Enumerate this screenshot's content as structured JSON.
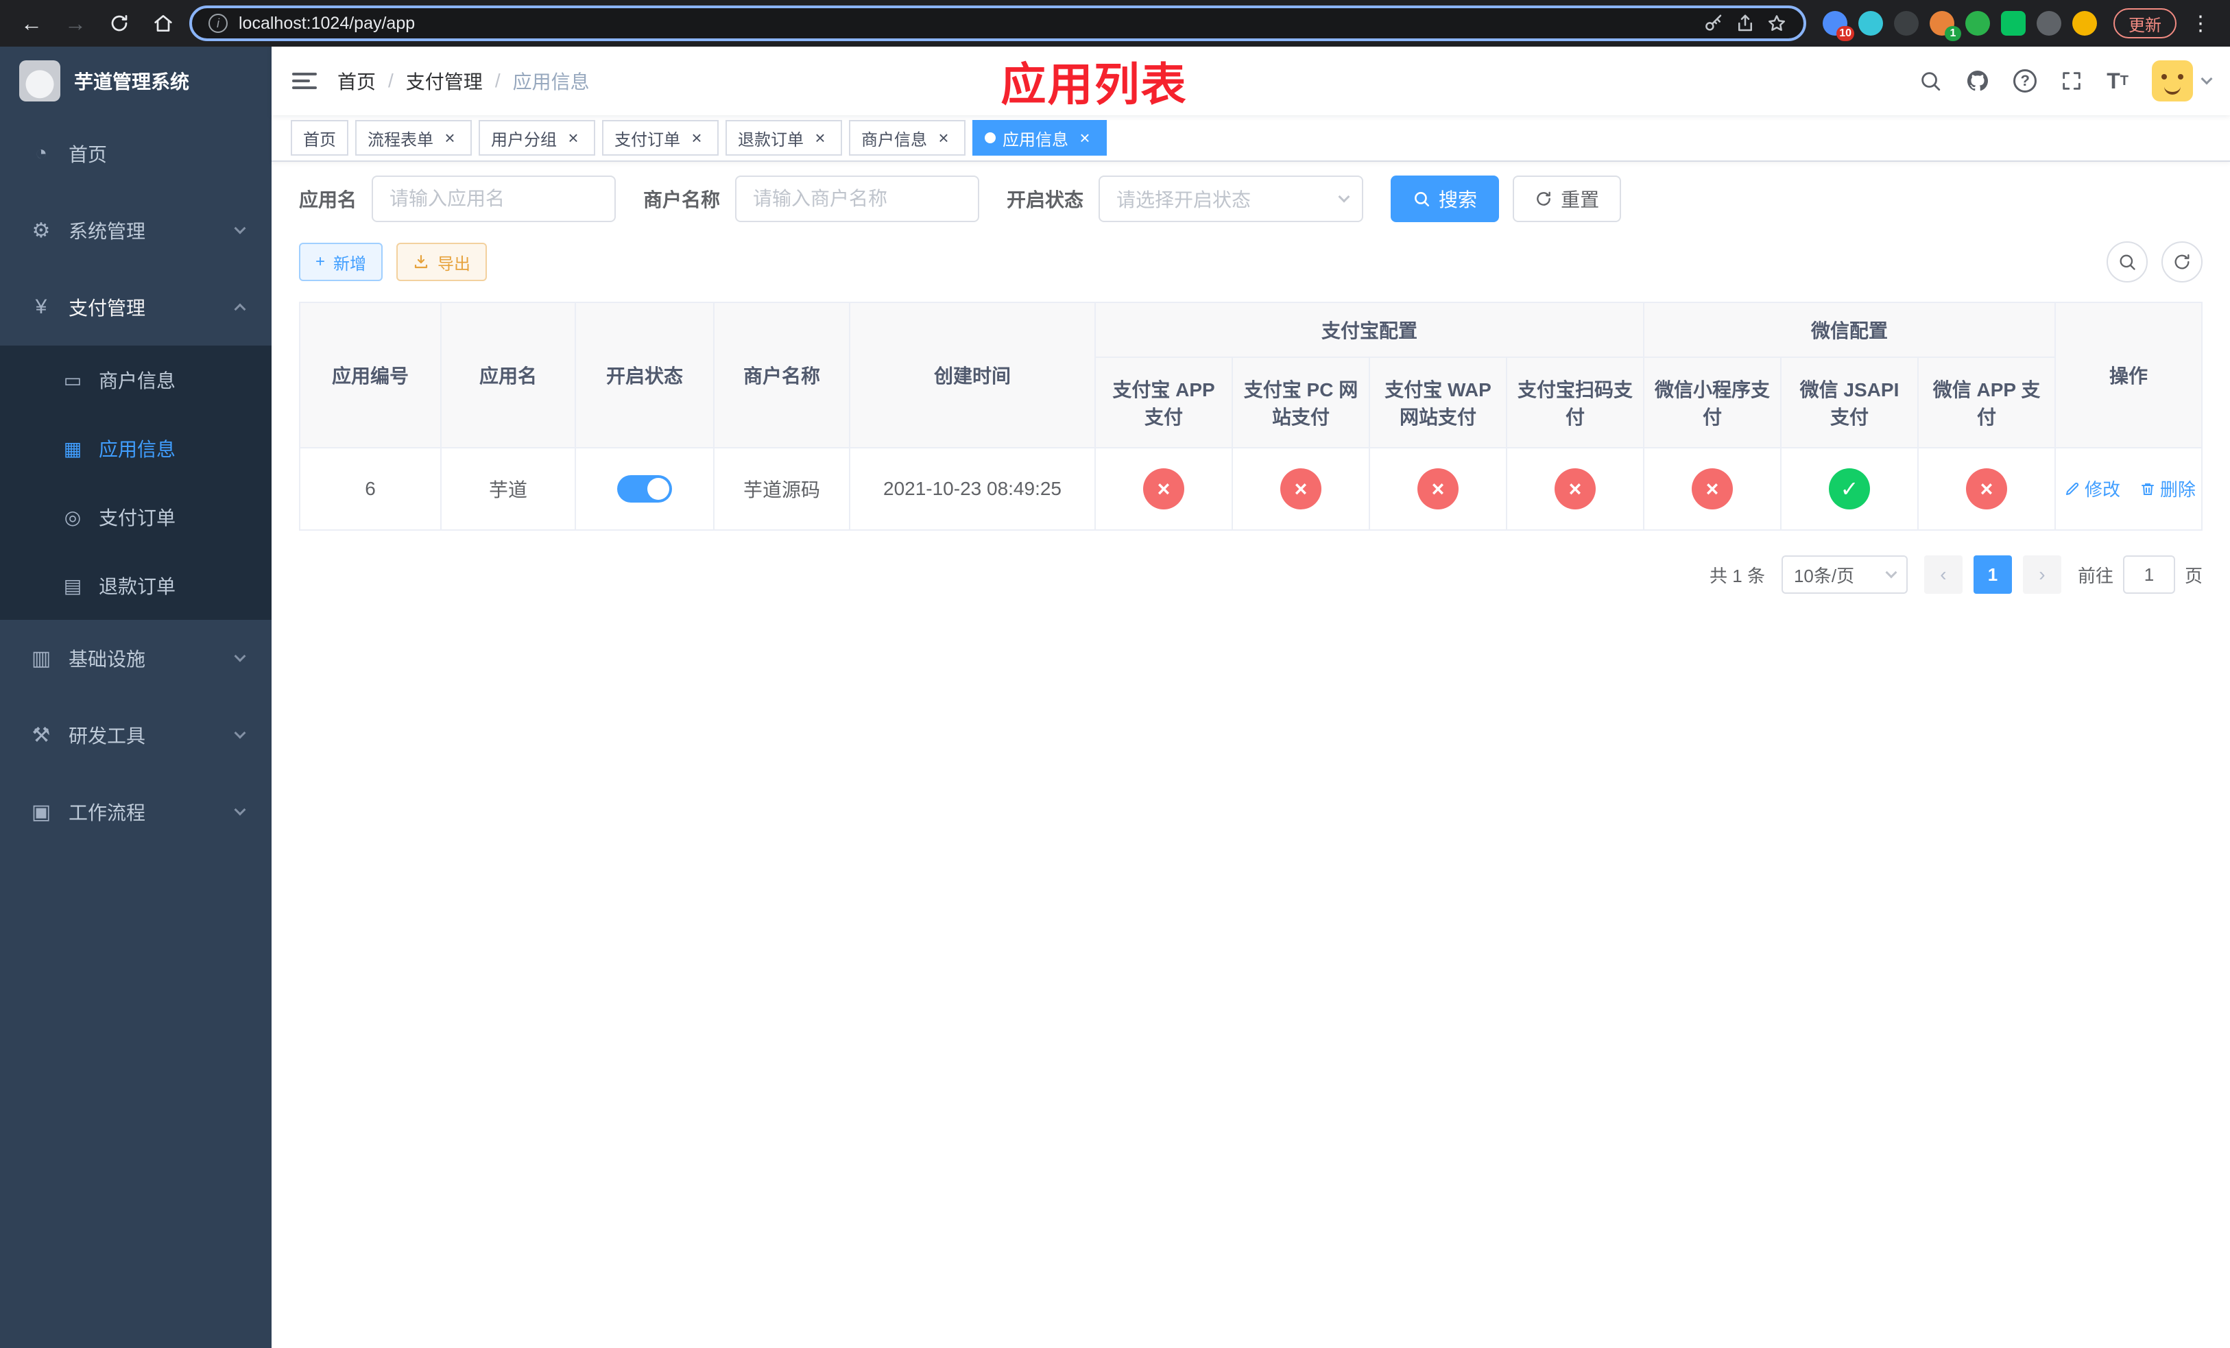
{
  "icons": {
    "back": "←",
    "forward": "→",
    "home": "⌂",
    "kebab": "⋮",
    "info": "i",
    "question": "?",
    "font_big": "T",
    "font_small": "T",
    "close": "×",
    "cross": "×",
    "check": "✓",
    "plus": "+",
    "prev": "‹",
    "next": "›",
    "dashboard": "◔",
    "gear": "⚙",
    "yen": "¥",
    "infra": "▥",
    "tools": "⚒",
    "workflow": "▣",
    "merchant": "▭",
    "app_grid": "▦",
    "pay_order": "◎",
    "refund": "▤"
  },
  "browser": {
    "url": "localhost:1024/pay/app",
    "update_button": "更新",
    "extension_badge_puzzle": "10",
    "extension_badge_profile": "1"
  },
  "sidebar": {
    "title": "芋道管理系统",
    "menu": [
      {
        "label": "首页"
      },
      {
        "label": "系统管理"
      },
      {
        "label": "支付管理"
      },
      {
        "label": "基础设施"
      },
      {
        "label": "研发工具"
      },
      {
        "label": "工作流程"
      }
    ],
    "payment_submenu": [
      {
        "label": "商户信息"
      },
      {
        "label": "应用信息"
      },
      {
        "label": "支付订单"
      },
      {
        "label": "退款订单"
      }
    ]
  },
  "header": {
    "breadcrumb": [
      "首页",
      "支付管理",
      "应用信息"
    ],
    "overlay_title": "应用列表"
  },
  "tabs": [
    {
      "label": "首页"
    },
    {
      "label": "流程表单"
    },
    {
      "label": "用户分组"
    },
    {
      "label": "支付订单"
    },
    {
      "label": "退款订单"
    },
    {
      "label": "商户信息"
    },
    {
      "label": "应用信息"
    }
  ],
  "filter": {
    "app_name_label": "应用名",
    "app_name_placeholder": "请输入应用名",
    "merchant_label": "商户名称",
    "merchant_placeholder": "请输入商户名称",
    "status_label": "开启状态",
    "status_placeholder": "请选择开启状态",
    "search_button": "搜索",
    "reset_button": "重置"
  },
  "toolbar": {
    "add_button": "新增",
    "export_button": "导出"
  },
  "table": {
    "headers": {
      "app_id": "应用编号",
      "app_name": "应用名",
      "status": "开启状态",
      "merchant": "商户名称",
      "created": "创建时间",
      "alipay_group": "支付宝配置",
      "wechat_group": "微信配置",
      "actions": "操作"
    },
    "subheaders": [
      "支付宝 APP 支付",
      "支付宝 PC 网站支付",
      "支付宝 WAP 网站支付",
      "支付宝扫码支付",
      "微信小程序支付",
      "微信 JSAPI 支付",
      "微信 APP 支付"
    ],
    "row": {
      "app_id": "6",
      "app_name": "芋道",
      "enabled": true,
      "merchant": "芋道源码",
      "created": "2021-10-23 08:49:25",
      "configs": [
        "disabled",
        "disabled",
        "disabled",
        "disabled",
        "disabled",
        "enabled",
        "disabled"
      ],
      "edit_action": "修改",
      "delete_action": "删除"
    }
  },
  "pagination": {
    "total": "共 1 条",
    "page_size": "10条/页",
    "current_page": "1",
    "goto_label": "前往",
    "goto_value": "1",
    "goto_suffix": "页"
  },
  "colors": {
    "accent": "#409eff",
    "danger": "#f56c6c",
    "success": "#13ce66",
    "title_red": "#f5222d",
    "sidebar_bg": "#304156",
    "submenu_bg": "#1f2d3d"
  }
}
